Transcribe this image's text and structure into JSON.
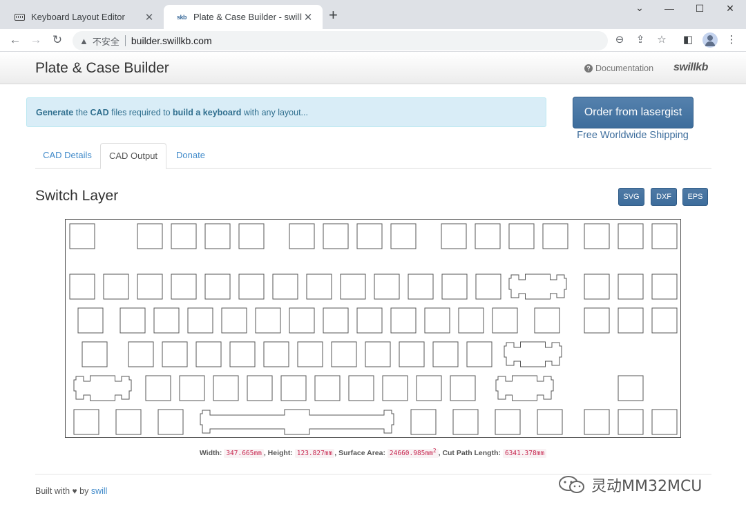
{
  "browser": {
    "tabs": [
      {
        "title": "Keyboard Layout Editor",
        "favicon": "keyboard-icon",
        "active": false
      },
      {
        "title": "Plate & Case Builder - swillkb",
        "favicon": "swillkb-favicon",
        "active": true
      }
    ],
    "new_tab": "+",
    "window_controls": {
      "dropdown": "⌄",
      "minimize": "—",
      "maximize": "☐",
      "close": "✕"
    },
    "address": {
      "security_label": "不安全",
      "url": "builder.swillkb.com"
    }
  },
  "header": {
    "title": "Plate & Case Builder",
    "documentation": "Documentation",
    "logo": "swillkb"
  },
  "alert": {
    "parts": [
      "Generate",
      " the ",
      "CAD",
      " files required to ",
      "build a keyboard",
      " with any layout..."
    ]
  },
  "order": {
    "button": "Order from lasergist",
    "subtitle": "Free Worldwide Shipping"
  },
  "tabs": [
    {
      "label": "CAD Details",
      "active": false
    },
    {
      "label": "CAD Output",
      "active": true
    },
    {
      "label": "Donate",
      "active": false
    }
  ],
  "layer": {
    "title": "Switch Layer",
    "downloads": [
      "SVG",
      "DXF",
      "EPS"
    ]
  },
  "stats": {
    "width_label": "Width:",
    "width": "347.665mm",
    "height_label": "Height:",
    "height": "123.827mm",
    "area_label": "Surface Area:",
    "area": "24660.985mm",
    "area_sup": "2",
    "cut_label": "Cut Path Length:",
    "cut": "6341.378mm"
  },
  "footer": {
    "built_with": "Built with",
    "by": "by",
    "author": "swill"
  },
  "watermark": "灵动MM32MCU"
}
